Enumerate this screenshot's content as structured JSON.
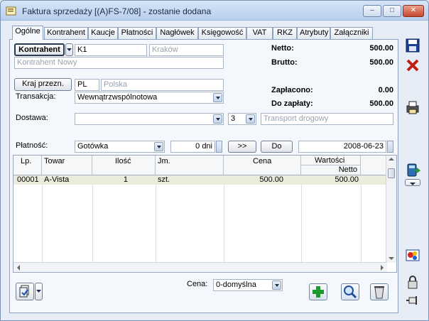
{
  "window": {
    "title": "Faktura sprzedaży [(A)FS-7/08]  - zostanie dodana",
    "min": "–",
    "max": "□",
    "close": "✕"
  },
  "tabs": [
    {
      "label": "Ogólne",
      "active": true
    },
    {
      "label": "Kontrahent"
    },
    {
      "label": "Kaucje"
    },
    {
      "label": "Płatności"
    },
    {
      "label": "Nagłówek"
    },
    {
      "label": "Księgowość"
    },
    {
      "label": "VAT"
    },
    {
      "label": "RKZ"
    },
    {
      "label": "Atrybuty"
    },
    {
      "label": "Załączniki"
    }
  ],
  "form": {
    "kontrahent_btn": "Kontrahent",
    "kontrahent_code": "K1",
    "kontrahent_city": "Kraków",
    "kontrahent_name": "Kontrahent Nowy",
    "kraj_btn": "Kraj przezn.",
    "kraj_code": "PL",
    "kraj_name": "Polska",
    "transakcja_label": "Transakcja:",
    "transakcja_value": "Wewnątrzwspólnotowa",
    "dostawa_label": "Dostawa:",
    "dostawa_value": "",
    "dostawa_num": "3",
    "dostawa_placeholder": "Transport drogowy",
    "platnosc_label": "Płatność:",
    "platnosc_value": "Gotówka",
    "dni_value": "0 dni",
    "arrow_btn": ">>",
    "do_btn": "Do",
    "date_value": "2008-06-23"
  },
  "summary": {
    "netto_label": "Netto:",
    "netto_value": "500.00",
    "brutto_label": "Brutto:",
    "brutto_value": "500.00",
    "zaplacono_label": "Zapłacono:",
    "zaplacono_value": "0.00",
    "dozaplaty_label": "Do zapłaty:",
    "dozaplaty_value": "500.00"
  },
  "grid": {
    "headers": {
      "lp": "Lp.",
      "towar": "Towar",
      "ilosc": "Ilość",
      "jm": "Jm.",
      "cena": "Cena",
      "wartosci": "Wartości",
      "netto": "Netto"
    },
    "rows": [
      {
        "lp": "00001",
        "towar": "A-Vista",
        "ilosc": "1",
        "jm": "szt.",
        "cena": "500.00",
        "netto": "500.00"
      }
    ]
  },
  "footer": {
    "cena_label": "Cena:",
    "cena_value": "0-domyślna"
  },
  "colors": {
    "accent": "#0b3a8c",
    "add": "#1d9a2c",
    "delete": "#c02010"
  }
}
